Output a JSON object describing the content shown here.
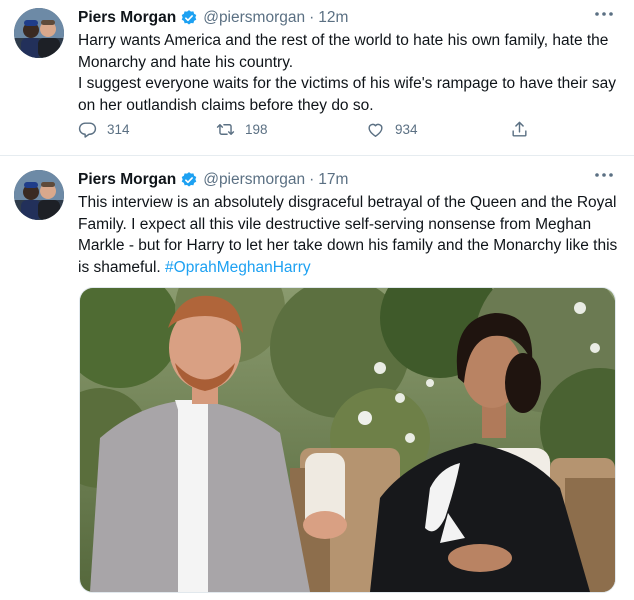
{
  "tweets": [
    {
      "author_name": "Piers Morgan",
      "handle": "@piersmorgan",
      "separator": "·",
      "time": "12m",
      "lines": [
        "Harry wants America and the rest of the world to hate his own family, hate the Monarchy and hate his country.",
        "I suggest everyone waits for the victims of his wife's rampage to have their say on her outlandish claims before they do so."
      ],
      "replies": "314",
      "retweets": "198",
      "likes": "934"
    },
    {
      "author_name": "Piers Morgan",
      "handle": "@piersmorgan",
      "separator": "·",
      "time": "17m",
      "text": "This interview is an absolutely disgraceful betrayal of the Queen and the Royal Family. I expect all this vile destructive self-serving nonsense from Meghan Markle - but for Harry to let her take down his family and the Monarchy like this is shameful.",
      "hashtag": "#OprahMeghanHarry"
    }
  ],
  "icons": {
    "verified": "verified-badge-icon",
    "more": "more-options-icon",
    "reply": "reply-icon",
    "retweet": "retweet-icon",
    "like": "like-icon",
    "share": "share-icon"
  },
  "colors": {
    "accent": "#1da1f2",
    "secondary_text": "#5b7083",
    "divider": "#e6ecf0"
  }
}
